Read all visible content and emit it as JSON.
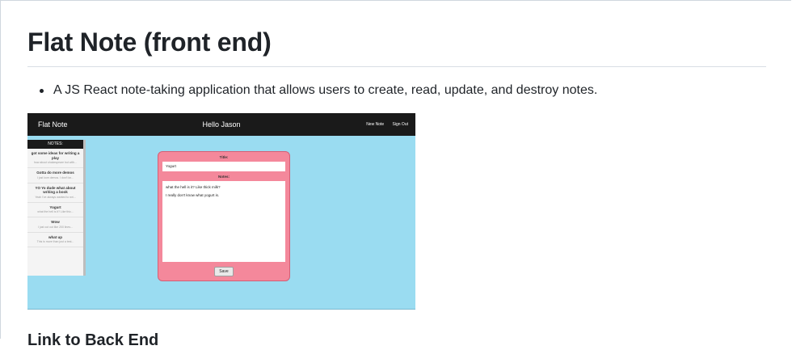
{
  "readme": {
    "title": "Flat Note (front end)",
    "bullets": [
      "A JS React note-taking application that allows users to create, read, update, and destroy notes."
    ],
    "next_heading": "Link to Back End"
  },
  "screenshot": {
    "navbar": {
      "brand": "Flat Note",
      "greeting": "Hello Jason",
      "links": [
        "New Note",
        "Sign Out"
      ]
    },
    "sidebar": {
      "header": "NOTES:",
      "notes": [
        {
          "title": "got some ideas for writing a play",
          "preview": "how about shakespeare but with..."
        },
        {
          "title": "Gotta do more demos",
          "preview": "I just love demos. I don't kn..."
        },
        {
          "title": "YO Yo dude what about writing a book",
          "preview": "Yeah I've always wanted to wri..."
        },
        {
          "title": "Yogurt",
          "preview": "what the hell is it? Like thic..."
        },
        {
          "title": "Wow",
          "preview": "I just cut out like 200 lines..."
        },
        {
          "title": "what up",
          "preview": "This is more than just a test..."
        }
      ]
    },
    "editor": {
      "title_label": "Title:",
      "title_value": "Yogurt",
      "notes_label": "Notes:",
      "notes_lines": [
        "what the hell is it? Like thick milk?",
        "I really don't know what yogurt is."
      ],
      "save_label": "Save"
    },
    "colors": {
      "background": "#9adcf1",
      "navbar": "#1a1a1a",
      "editor": "#f4889b"
    }
  }
}
